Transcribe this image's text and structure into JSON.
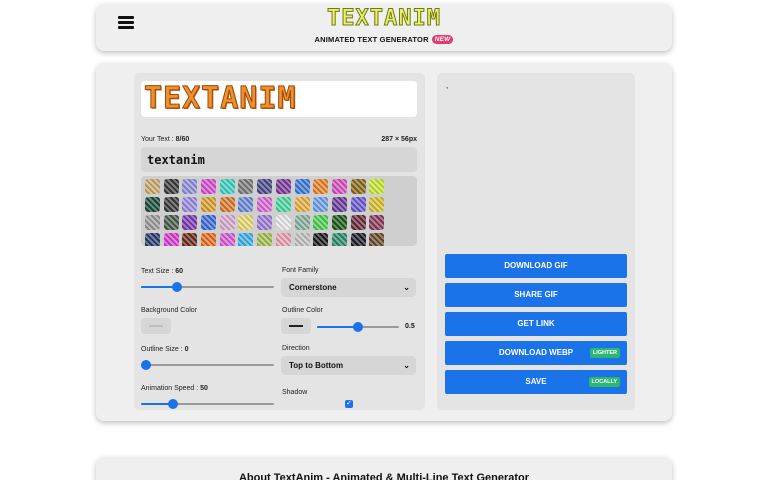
{
  "header": {
    "logo": "TEXTANIM",
    "tagline": "ANIMATED TEXT GENERATOR",
    "new_badge": "NEW"
  },
  "preview": {
    "text": "TEXTANIM"
  },
  "text_field": {
    "label_prefix": "Your Text : ",
    "count": "8/60",
    "dimensions": "287 × 56px",
    "value": "textanim"
  },
  "swatches": [
    "#c9a96e",
    "#3a3a3a",
    "#8f8fd8",
    "#d64fd0",
    "#3bd1c0",
    "#7a7a7a",
    "#4a4a8a",
    "#7a3a9a",
    "#3a7ad8",
    "#e8822a",
    "#d84fc0",
    "#8a6a1a",
    "#c8e830",
    "#1a4a3a",
    "#3a3a3a",
    "#9a8ae0",
    "#d8a030",
    "#d87a2a",
    "#6a8ad8",
    "#d86ad8",
    "#4ad8a0",
    "#e8b040",
    "#6aa0e8",
    "#6a3a9a",
    "#6a5ad0",
    "#d8c030",
    "#9a9a9a",
    "#4a5a4a",
    "#7a3ab0",
    "#3a6ad8",
    "#d8a8d0",
    "#e8d870",
    "#a07ad8",
    "#e8e8e8",
    "#8ab0a0",
    "#4ad050",
    "#1a5a1a",
    "#6a2a3a",
    "#8a3a5a",
    "#2a3a6a",
    "#d83ad0",
    "#6a2a1a",
    "#e86a1a",
    "#d85ad8",
    "#3ab0e8",
    "#a0c050",
    "#e8a0b0",
    "#c0c0c0",
    "#1a1a1a",
    "#2a8a6a",
    "#1a1a2a",
    "#6a4a2a",
    "#2a7a1a",
    "#5a3a5a",
    "#4ab04a",
    "#e85a6a"
  ],
  "controls": {
    "text_size": {
      "label": "Text Size : ",
      "value": "60",
      "fraction": 0.27
    },
    "font_family": {
      "label": "Font Family",
      "value": "Cornerstone"
    },
    "background_color": {
      "label": "Background Color"
    },
    "outline_color": {
      "label": "Outline Color",
      "value": "0.5",
      "fraction": 0.5,
      "color": "#222222"
    },
    "outline_size": {
      "label": "Outline Size : ",
      "value": "0",
      "fraction": 0.0
    },
    "direction": {
      "label": "Direction",
      "value": "Top to Bottom"
    },
    "animation_speed": {
      "label": "Animation Speed : ",
      "value": "50",
      "fraction": 0.24
    },
    "shadow": {
      "label": "Shadow",
      "checked": true
    }
  },
  "side": {
    "placeholder": ",",
    "buttons": [
      {
        "label": "DOWNLOAD GIF",
        "badge": ""
      },
      {
        "label": "SHARE GIF",
        "badge": ""
      },
      {
        "label": "GET LINK",
        "badge": ""
      },
      {
        "label": "DOWNLOAD WEBP",
        "badge": "LIGHTER"
      },
      {
        "label": "SAVE",
        "badge": "LOCALLY"
      }
    ]
  },
  "about": {
    "title": "About TextAnim - Animated & Multi-Line Text Generator"
  },
  "colors": {
    "accent": "#1a73e8",
    "badge_green": "#2bb673",
    "new_badge": "#e23a6a"
  }
}
